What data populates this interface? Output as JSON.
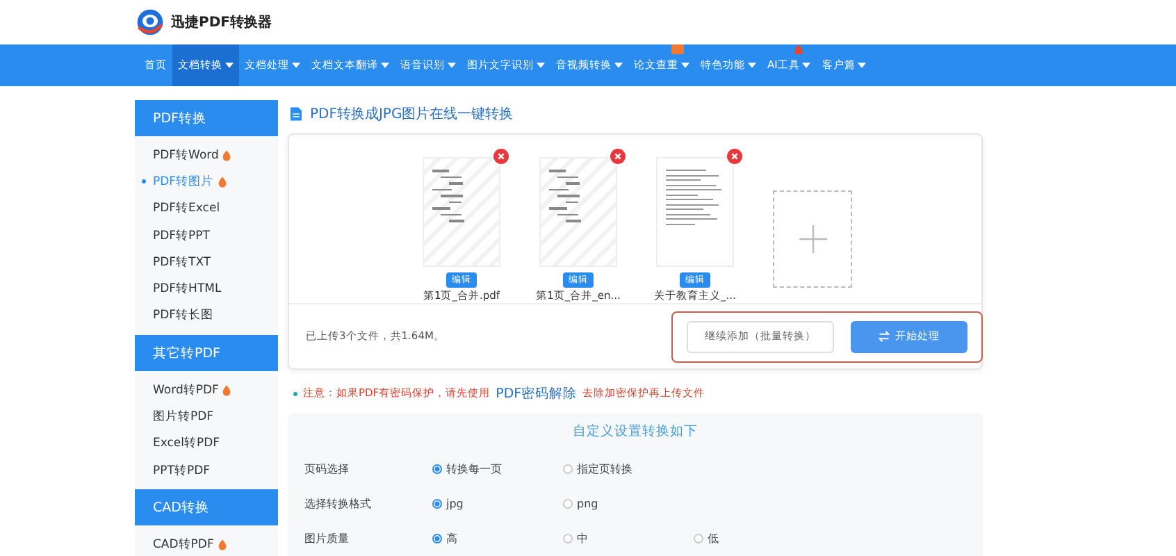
{
  "brand": {
    "name": "迅捷PDF转换器"
  },
  "nav": [
    {
      "label": "首页",
      "dropdown": false,
      "selected": false,
      "is_new": false,
      "hot": false
    },
    {
      "label": "文档转换",
      "dropdown": true,
      "selected": true,
      "is_new": false,
      "hot": false
    },
    {
      "label": "文档处理",
      "dropdown": true,
      "selected": false,
      "is_new": false,
      "hot": false
    },
    {
      "label": "文档文本翻译",
      "dropdown": true,
      "selected": false,
      "is_new": false,
      "hot": false
    },
    {
      "label": "语音识别",
      "dropdown": true,
      "selected": false,
      "is_new": false,
      "hot": false
    },
    {
      "label": "图片文字识别",
      "dropdown": true,
      "selected": false,
      "is_new": false,
      "hot": false
    },
    {
      "label": "音视频转换",
      "dropdown": true,
      "selected": false,
      "is_new": false,
      "hot": false
    },
    {
      "label": "论文查重",
      "dropdown": true,
      "selected": false,
      "is_new": true,
      "hot": false
    },
    {
      "label": "特色功能",
      "dropdown": true,
      "selected": false,
      "is_new": false,
      "hot": false
    },
    {
      "label": "AI工具",
      "dropdown": true,
      "selected": false,
      "is_new": false,
      "hot": true
    },
    {
      "label": "客户篇",
      "dropdown": true,
      "selected": false,
      "is_new": false,
      "hot": false
    }
  ],
  "sidebar": [
    {
      "title": "PDF转换",
      "items": [
        {
          "label": "PDF转Word",
          "hot": true,
          "selected": false
        },
        {
          "label": "PDF转图片",
          "hot": true,
          "selected": true
        },
        {
          "label": "PDF转Excel",
          "hot": false,
          "selected": false
        },
        {
          "label": "PDF转PPT",
          "hot": false,
          "selected": false
        },
        {
          "label": "PDF转TXT",
          "hot": false,
          "selected": false
        },
        {
          "label": "PDF转HTML",
          "hot": false,
          "selected": false
        },
        {
          "label": "PDF转长图",
          "hot": false,
          "selected": false
        }
      ]
    },
    {
      "title": "其它转PDF",
      "items": [
        {
          "label": "Word转PDF",
          "hot": true,
          "selected": false
        },
        {
          "label": "图片转PDF",
          "hot": false,
          "selected": false
        },
        {
          "label": "Excel转PDF",
          "hot": false,
          "selected": false
        },
        {
          "label": "PPT转PDF",
          "hot": false,
          "selected": false
        }
      ]
    },
    {
      "title": "CAD转换",
      "items": [
        {
          "label": "CAD转PDF",
          "hot": true,
          "selected": false
        }
      ]
    }
  ],
  "main": {
    "title": "PDF转换成JPG图片在线一键转换",
    "files": [
      {
        "name": "第1页_合并.pdf",
        "kind": "outline",
        "edit": "编辑"
      },
      {
        "name": "第1页_合并_en...",
        "kind": "outline",
        "edit": "编辑"
      },
      {
        "name": "关于教育主义_...",
        "kind": "text",
        "edit": "编辑"
      }
    ],
    "status": "已上传3个文件，共1.64M。",
    "buttons": [
      {
        "label": "继续添加（批量转换）",
        "kind": "secondary"
      },
      {
        "label": "开始处理",
        "kind": "primary"
      }
    ],
    "note": {
      "before": "注意：如果PDF有密码保护，请先使用",
      "link": "PDF密码解除",
      "after": "去除加密保护再上传文件"
    },
    "settings": {
      "title": "自定义设置转换如下",
      "rows": [
        {
          "label": "页码选择",
          "options": [
            {
              "label": "转换每一页",
              "selected": true
            },
            {
              "label": "指定页转换",
              "selected": false
            }
          ]
        },
        {
          "label": "选择转换格式",
          "options": [
            {
              "label": "jpg",
              "selected": true
            },
            {
              "label": "png",
              "selected": false
            }
          ]
        },
        {
          "label": "图片质量",
          "options": [
            {
              "label": "高",
              "selected": true
            },
            {
              "label": "中",
              "selected": false
            },
            {
              "label": "低",
              "selected": false
            }
          ]
        }
      ]
    }
  }
}
